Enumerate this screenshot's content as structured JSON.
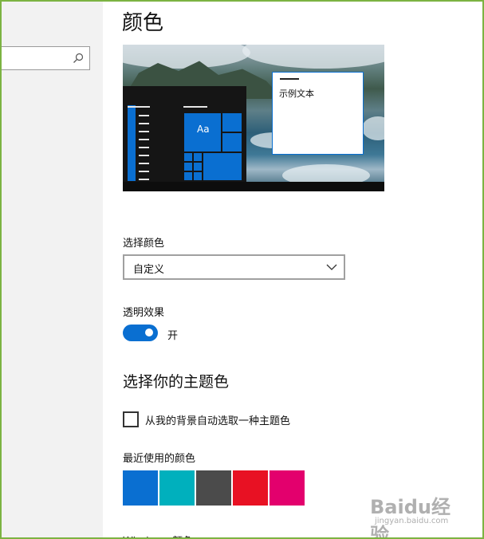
{
  "header": {
    "title": "颜色"
  },
  "search": {
    "placeholder": "",
    "icon": "search-icon"
  },
  "preview": {
    "sample_text": "示例文本",
    "tile_text": "Aa",
    "accent": "#0a6fd1"
  },
  "choose_color": {
    "label": "选择颜色",
    "selected": "自定义"
  },
  "transparency": {
    "label": "透明效果",
    "state": "开",
    "on": true
  },
  "accent_section": {
    "title": "选择你的主题色",
    "auto_pick_label": "从我的背景自动选取一种主题色",
    "auto_pick_checked": false
  },
  "recent": {
    "label": "最近使用的颜色",
    "colors": [
      "#0a6fd1",
      "#00b0bd",
      "#4b4b4b",
      "#e81123",
      "#e3006d"
    ]
  },
  "windows_colors": {
    "label": "Windows 颜色"
  },
  "watermark": {
    "brand": "Baidu经验",
    "url": "jingyan.baidu.com"
  }
}
